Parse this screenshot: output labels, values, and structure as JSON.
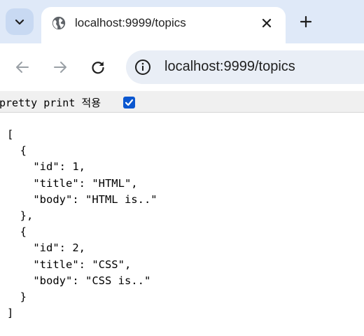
{
  "browser": {
    "tab_title": "localhost:9999/topics",
    "url": "localhost:9999/topics",
    "icons": {
      "tab_search": "chevron-down-icon",
      "favicon": "globe-icon",
      "close": "close-icon",
      "new_tab": "plus-icon",
      "back": "back-arrow-icon",
      "forward": "forward-arrow-icon",
      "reload": "reload-icon",
      "site_info": "info-icon"
    }
  },
  "pretty_print": {
    "label": "pretty print 적용",
    "checked": true
  },
  "json_lines": [
    "[",
    "  {",
    "    \"id\": 1,",
    "    \"title\": \"HTML\",",
    "    \"body\": \"HTML is..\"",
    "  },",
    "  {",
    "    \"id\": 2,",
    "    \"title\": \"CSS\",",
    "    \"body\": \"CSS is..\"",
    "  }",
    "]"
  ]
}
